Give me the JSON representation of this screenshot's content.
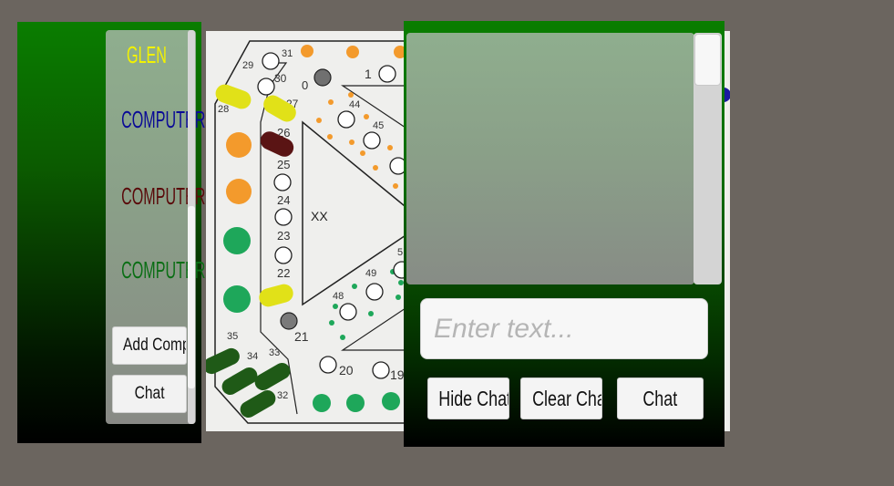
{
  "players_panel": {
    "players": [
      {
        "name": "GLEN",
        "color": "#f2f200"
      },
      {
        "name": "COMPUTER",
        "color": "#0a0a96"
      },
      {
        "name": "COMPUTER",
        "color": "#5a0a0a"
      },
      {
        "name": "COMPUTER",
        "color": "#0a6e14"
      }
    ],
    "add_computer_label": "Add Computer",
    "chat_label": "Chat"
  },
  "board": {
    "center_label": "XX",
    "hole_numbers": [
      "0",
      "1",
      "19",
      "20",
      "21",
      "22",
      "23",
      "24",
      "25",
      "26",
      "27",
      "28",
      "29",
      "30",
      "31",
      "32",
      "33",
      "34",
      "35",
      "44",
      "45",
      "48",
      "49",
      "5"
    ],
    "colors": {
      "orange": "#f39a2c",
      "green": "#1ea75a",
      "yellow_peg": "#e1e118",
      "maroon_peg": "#5a1414",
      "dark_green_peg": "#1f5a17",
      "gray_hole": "#7a7a7a"
    }
  },
  "chat": {
    "input_placeholder": "Enter text...",
    "hide_chat_label": "Hide Chat",
    "clear_chat_label": "Clear Chat",
    "chat_label": "Chat"
  }
}
